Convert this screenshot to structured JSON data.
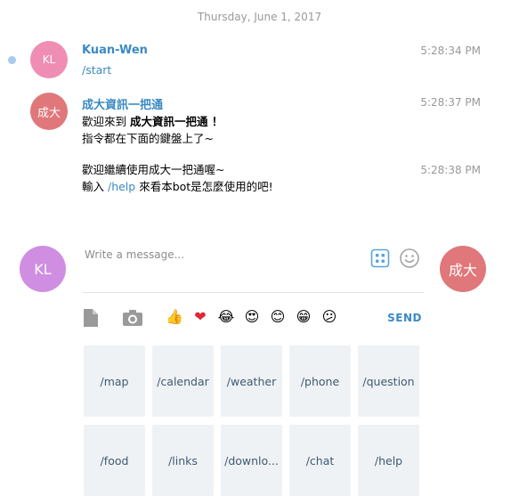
{
  "date": "Thursday, June 1, 2017",
  "messages": [
    {
      "avatar": "KL",
      "sender": "Kuan-Wen",
      "time": "5:28:34 PM",
      "text": "/start"
    },
    {
      "avatar": "成大",
      "sender": "成大資訊一把通",
      "time": "5:28:37 PM",
      "line1_prefix": "歡迎來到 ",
      "line1_bold": "成大資訊一把通 ！",
      "line2": "指令都在下面的鍵盤上了~"
    },
    {
      "time": "5:28:38 PM",
      "line1": "歡迎繼續使用成大一把通喔~",
      "line2_prefix": "輸入 ",
      "line2_cmd": "/help",
      "line2_suffix": " 來看本bot是怎麼使用的吧!"
    }
  ],
  "composer": {
    "placeholder": "Write a message...",
    "user_avatar": "KL",
    "bot_avatar": "成大",
    "send_label": "SEND",
    "icons": [
      "bot-keyboard-icon",
      "emoji-smile-icon",
      "file-attach-icon",
      "camera-icon"
    ]
  },
  "emojis": [
    "👍",
    "❤",
    "😂",
    "😍",
    "😊",
    "😁",
    "😕"
  ],
  "keyboard": [
    [
      "/map",
      "/calendar",
      "/weather",
      "/phone",
      "/question"
    ],
    [
      "/food",
      "/links",
      "/downlo...",
      "/chat",
      "/help"
    ]
  ],
  "colors": {
    "accent": "#3a8ac4",
    "user_avatar": "#f08db3",
    "bot_avatar": "#e0777a",
    "composer_user_avatar": "#cf8ee2",
    "keyboard_button": "#eff2f5"
  }
}
